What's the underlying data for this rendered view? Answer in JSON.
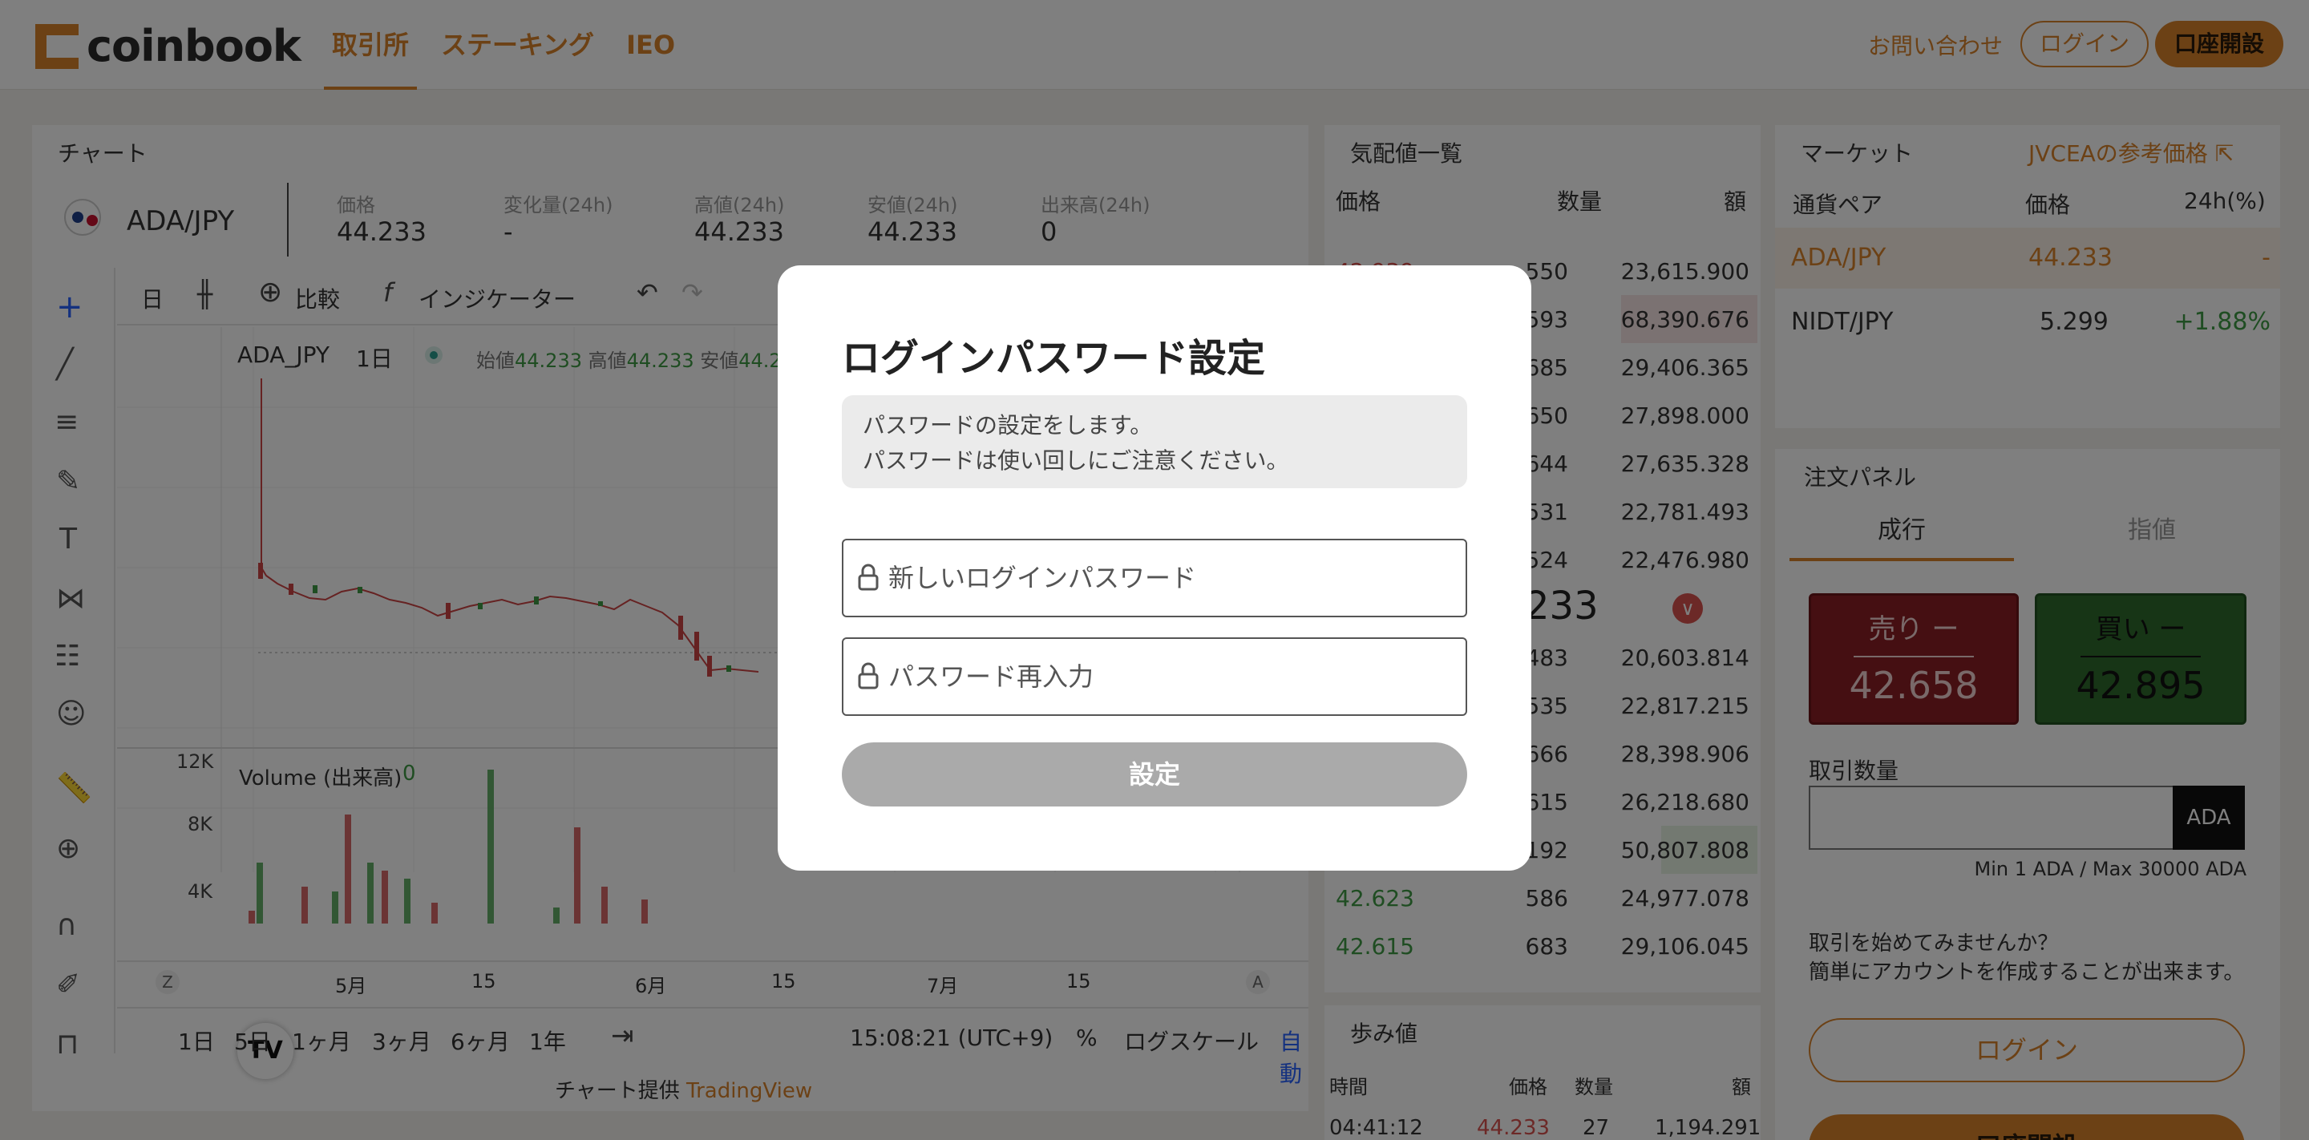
{
  "header": {
    "logo_text": "coinbook",
    "nav": [
      "取引所",
      "ステーキング",
      "IEO"
    ],
    "contact": "お問い合わせ",
    "login": "ログイン",
    "open_account": "口座開設"
  },
  "chart_panel": {
    "title": "チャート",
    "pair": "ADA/JPY",
    "stats": [
      {
        "label": "価格",
        "value": "44.233"
      },
      {
        "label": "変化量(24h)",
        "value": "-"
      },
      {
        "label": "高値(24h)",
        "value": "44.233"
      },
      {
        "label": "安値(24h)",
        "value": "44.233"
      },
      {
        "label": "出来高(24h)",
        "value": "0"
      }
    ],
    "toolbar": {
      "interval": "日",
      "compare": "比較",
      "indicators": "インジケーター"
    },
    "legend": {
      "symbol": "ADA_JPY",
      "interval": "1日",
      "open_label": "始値",
      "open": "44.233",
      "high_label": "高値",
      "high": "44.233",
      "low_label": "安値",
      "low": "44.2"
    },
    "volume_label": "Volume (出来高)",
    "volume_value": "0",
    "volume_ticks": [
      "12K",
      "8K",
      "4K"
    ],
    "x_ticks": [
      "5月",
      "15",
      "6月",
      "15",
      "7月",
      "15"
    ],
    "axis_left": "Z",
    "axis_right": "A",
    "ranges": [
      "1日",
      "5日",
      "1ヶ月",
      "3ヶ月",
      "6ヶ月",
      "1年"
    ],
    "time": "15:08:21 (UTC+9)",
    "percent": "%",
    "log_scale": "ログスケール",
    "auto": "自動",
    "credit_prefix": "チャート提供",
    "credit_link": "TradingView"
  },
  "orderbook": {
    "title": "気配値一覧",
    "headers": [
      "価格",
      "数量",
      "額"
    ],
    "asks": [
      {
        "price": "42.939",
        "qty": "550",
        "amount": "23,615.900"
      },
      {
        "price": "",
        "qty": "1,593",
        "amount": "68,390.676"
      },
      {
        "price": "",
        "qty": "685",
        "amount": "29,406.365"
      },
      {
        "price": "",
        "qty": "650",
        "amount": "27,898.000"
      },
      {
        "price": "",
        "qty": "644",
        "amount": "27,635.328"
      },
      {
        "price": "",
        "qty": "531",
        "amount": "22,781.493"
      },
      {
        "price": "",
        "qty": "524",
        "amount": "22,476.980"
      }
    ],
    "mid_price": "233",
    "bids": [
      {
        "price": "",
        "qty": "483",
        "amount": "20,603.814"
      },
      {
        "price": "",
        "qty": "535",
        "amount": "22,817.215"
      },
      {
        "price": "",
        "qty": "666",
        "amount": "28,398.906"
      },
      {
        "price": "",
        "qty": "615",
        "amount": "26,218.680"
      },
      {
        "price": "",
        "qty": "1,192",
        "amount": "50,807.808"
      },
      {
        "price": "42.623",
        "qty": "586",
        "amount": "24,977.078"
      },
      {
        "price": "42.615",
        "qty": "683",
        "amount": "29,106.045"
      }
    ]
  },
  "trades": {
    "title": "歩み値",
    "headers": [
      "時間",
      "価格",
      "数量",
      "額"
    ],
    "row": {
      "time": "04:41:12",
      "price": "44.233",
      "qty": "27",
      "amount": "1,194.291"
    }
  },
  "market": {
    "title": "マーケット",
    "ref_link": "JVCEAの参考価格",
    "headers": [
      "通貨ペア",
      "価格",
      "24h(%)"
    ],
    "rows": [
      {
        "pair": "ADA/JPY",
        "price": "44.233",
        "change": "-"
      },
      {
        "pair": "NIDT/JPY",
        "price": "5.299",
        "change": "+1.88%"
      }
    ]
  },
  "order_panel": {
    "title": "注文パネル",
    "tabs": [
      "成行",
      "指値"
    ],
    "sell_label": "売り ー",
    "sell_price": "42.658",
    "buy_label": "買い ー",
    "buy_price": "42.895",
    "qty_label": "取引数量",
    "unit": "ADA",
    "minmax": "Min 1 ADA / Max 30000 ADA",
    "promo_line1": "取引を始めてみませんか？",
    "promo_line2": "簡単にアカウントを作成することが出来ます。",
    "login": "ログイン",
    "open_account": "口座開設"
  },
  "modal": {
    "title": "ログインパスワード設定",
    "notice_line1": "パスワードの設定をします。",
    "notice_line2": "パスワードは使い回しにご注意ください。",
    "new_password_placeholder": "新しいログインパスワード",
    "confirm_password_placeholder": "パスワード再入力",
    "submit": "設定"
  },
  "colors": {
    "accent": "#d9822b",
    "sell": "#8a1f24",
    "buy": "#2f6b2c",
    "up": "#3f9a44",
    "down": "#d9534f"
  }
}
